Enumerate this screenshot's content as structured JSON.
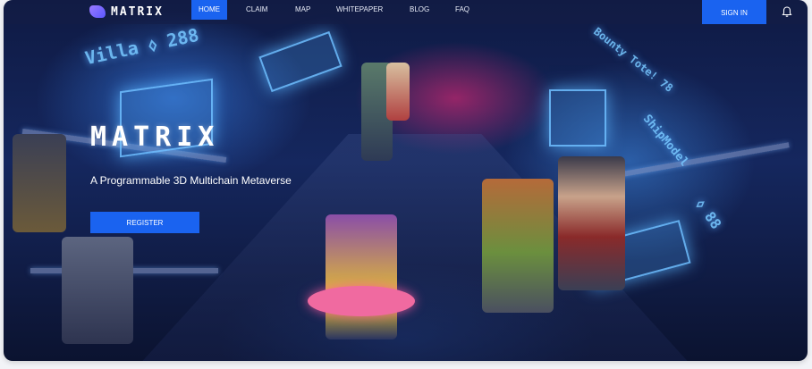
{
  "nav": {
    "logo_text": "MATRIX",
    "links": [
      {
        "label": "HOME",
        "active": true
      },
      {
        "label": "CLAIM",
        "active": false
      },
      {
        "label": "MAP",
        "active": false
      },
      {
        "label": "WHITEPAPER",
        "active": false
      },
      {
        "label": "BLOG",
        "active": false
      },
      {
        "label": "FAQ",
        "active": false
      }
    ],
    "signin_label": "SIGN IN",
    "bell_icon": "bell-icon"
  },
  "hero": {
    "title": "MATRIX",
    "subtitle": "A Programmable 3D Multichain Metaverse",
    "register_label": "REGISTER"
  },
  "scene": {
    "sign_left": "Villa ⬨ 288",
    "sign_right_top": "Bounty Tote! 78",
    "sign_right_mid": "ShipModel",
    "sign_right_num": "⬨ 88"
  },
  "colors": {
    "accent": "#1a63f0",
    "text": "#ffffff"
  }
}
